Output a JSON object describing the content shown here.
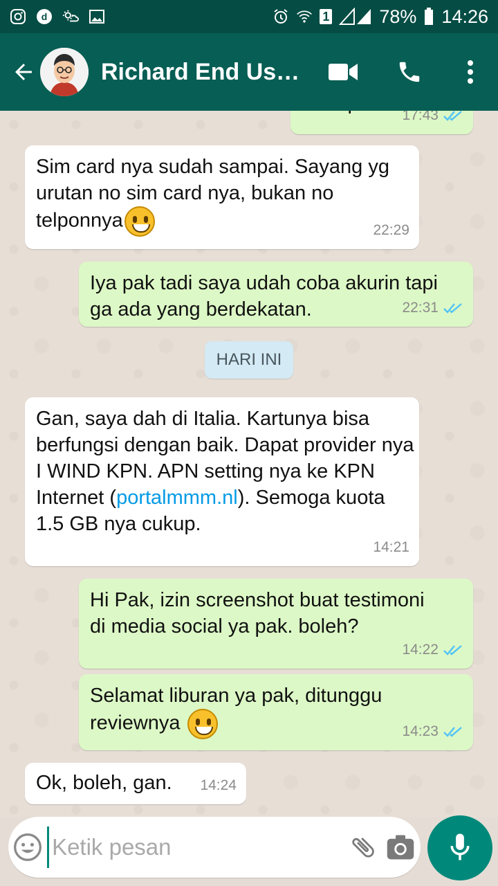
{
  "status_bar": {
    "battery": "78%",
    "time": "14:26",
    "sim_badge": "1"
  },
  "header": {
    "contact_name": "Richard End User..."
  },
  "chat": {
    "top_partial": {
      "text": "Baik pak",
      "time": "17:43"
    },
    "day_divider": "HARI INI",
    "messages": [
      {
        "side": "in",
        "text": "Sim card nya sudah sampai. Sayang yg urutan no sim card nya, bukan no telponnya",
        "time": "22:29"
      },
      {
        "side": "out",
        "text": "Iya pak tadi saya udah coba akurin tapi ga ada yang berdekatan.",
        "time": "22:31"
      },
      {
        "side": "in",
        "text_before_link": "Gan, saya dah di Italia. Kartunya bisa berfungsi dengan baik. Dapat provider nya I WIND KPN. APN setting nya ke KPN Internet (",
        "link": "portalmmm.nl",
        "text_after_link": "). Semoga kuota 1.5 GB nya cukup.",
        "time": "14:21"
      },
      {
        "side": "out",
        "text": "Hi Pak, izin screenshot buat testimoni di media social ya pak. boleh?",
        "time": "14:22"
      },
      {
        "side": "out",
        "text": "Selamat liburan ya pak, ditunggu reviewnya",
        "time": "14:23"
      },
      {
        "side": "in",
        "text": "Ok, boleh, gan.",
        "time": "14:24"
      }
    ]
  },
  "composer": {
    "placeholder": "Ketik pesan",
    "value": ""
  },
  "icons": {
    "status_left": [
      "instagram-icon",
      "d-app-icon",
      "weather-icon",
      "gallery-icon"
    ],
    "status_right": [
      "alarm-icon",
      "wifi-icon",
      "signal-icon",
      "battery-icon"
    ],
    "header": [
      "back-arrow-icon",
      "video-call-icon",
      "phone-icon",
      "more-vert-icon"
    ],
    "composer": [
      "emoji-icon",
      "attach-icon",
      "camera-icon",
      "mic-icon"
    ]
  },
  "colors": {
    "header": "#075e54",
    "status_bar": "#054d44",
    "outgoing_bubble": "#dcf8c6",
    "incoming_bubble": "#ffffff",
    "read_tick": "#4fc3f7",
    "accent": "#00897b",
    "link": "#039be5"
  }
}
